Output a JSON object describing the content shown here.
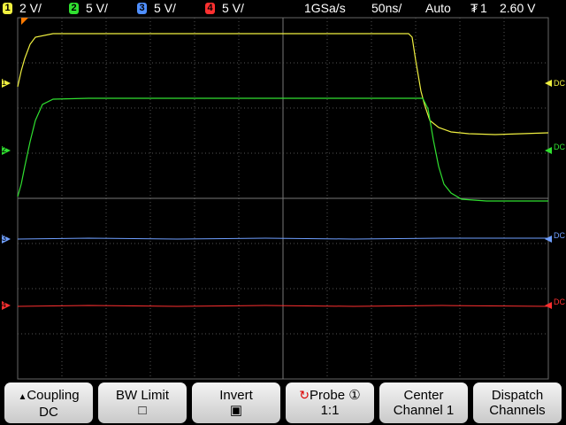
{
  "channels": [
    {
      "num": "1",
      "scale": "2 V/",
      "color": "#f0f040"
    },
    {
      "num": "2",
      "scale": "5 V/",
      "color": "#30e030"
    },
    {
      "num": "3",
      "scale": "5 V/",
      "color": "#4f8fff"
    },
    {
      "num": "4",
      "scale": "5 V/",
      "color": "#ff3030"
    }
  ],
  "timebase": {
    "sample_rate": "1GSa/s",
    "timediv": "50ns/"
  },
  "trigger": {
    "mode": "Auto",
    "source_symbol": "₮",
    "source": "1",
    "level": "2.60 V"
  },
  "markers": {
    "ch1": "1",
    "ch2": "2",
    "ch3": "3",
    "ch4": "4",
    "coupling_dc": "DC"
  },
  "softkeys": [
    {
      "name": "coupling",
      "line1": "Coupling",
      "line2": "DC"
    },
    {
      "name": "bw-limit",
      "line1": "BW Limit",
      "line2": "□"
    },
    {
      "name": "invert",
      "line1": "Invert",
      "line2": "▣"
    },
    {
      "name": "probe",
      "line1": "Probe ①",
      "line2": "1:1"
    },
    {
      "name": "center",
      "line1": "Center",
      "line2": "Channel 1"
    },
    {
      "name": "dispatch",
      "line1": "Dispatch",
      "line2": "Channels"
    }
  ]
}
